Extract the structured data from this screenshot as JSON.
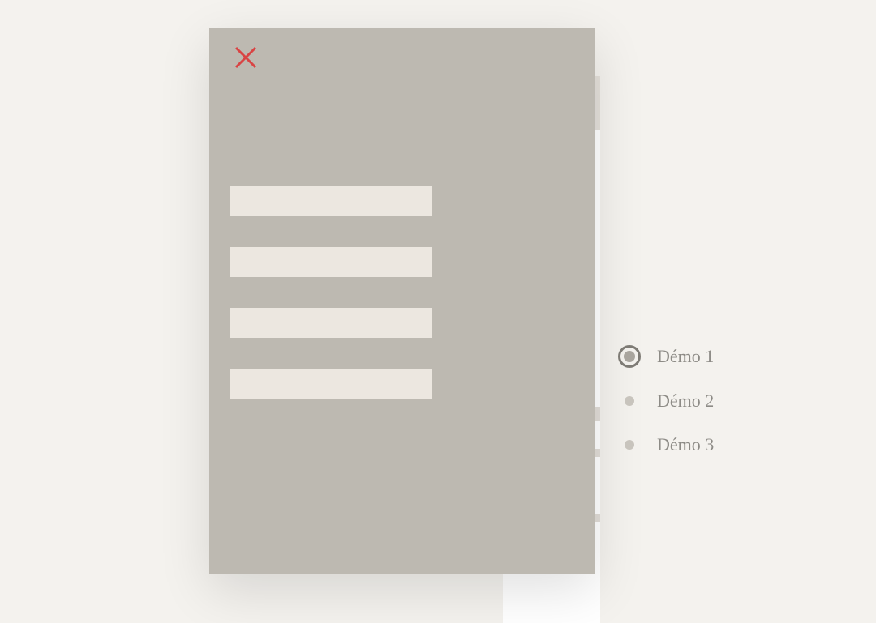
{
  "overlay": {
    "rows": [
      {
        "label": ""
      },
      {
        "label": ""
      },
      {
        "label": ""
      },
      {
        "label": ""
      }
    ]
  },
  "demo_nav": {
    "items": [
      {
        "label": "Démo 1",
        "active": true
      },
      {
        "label": "Démo 2",
        "active": false
      },
      {
        "label": "Démo 3",
        "active": false
      }
    ]
  }
}
